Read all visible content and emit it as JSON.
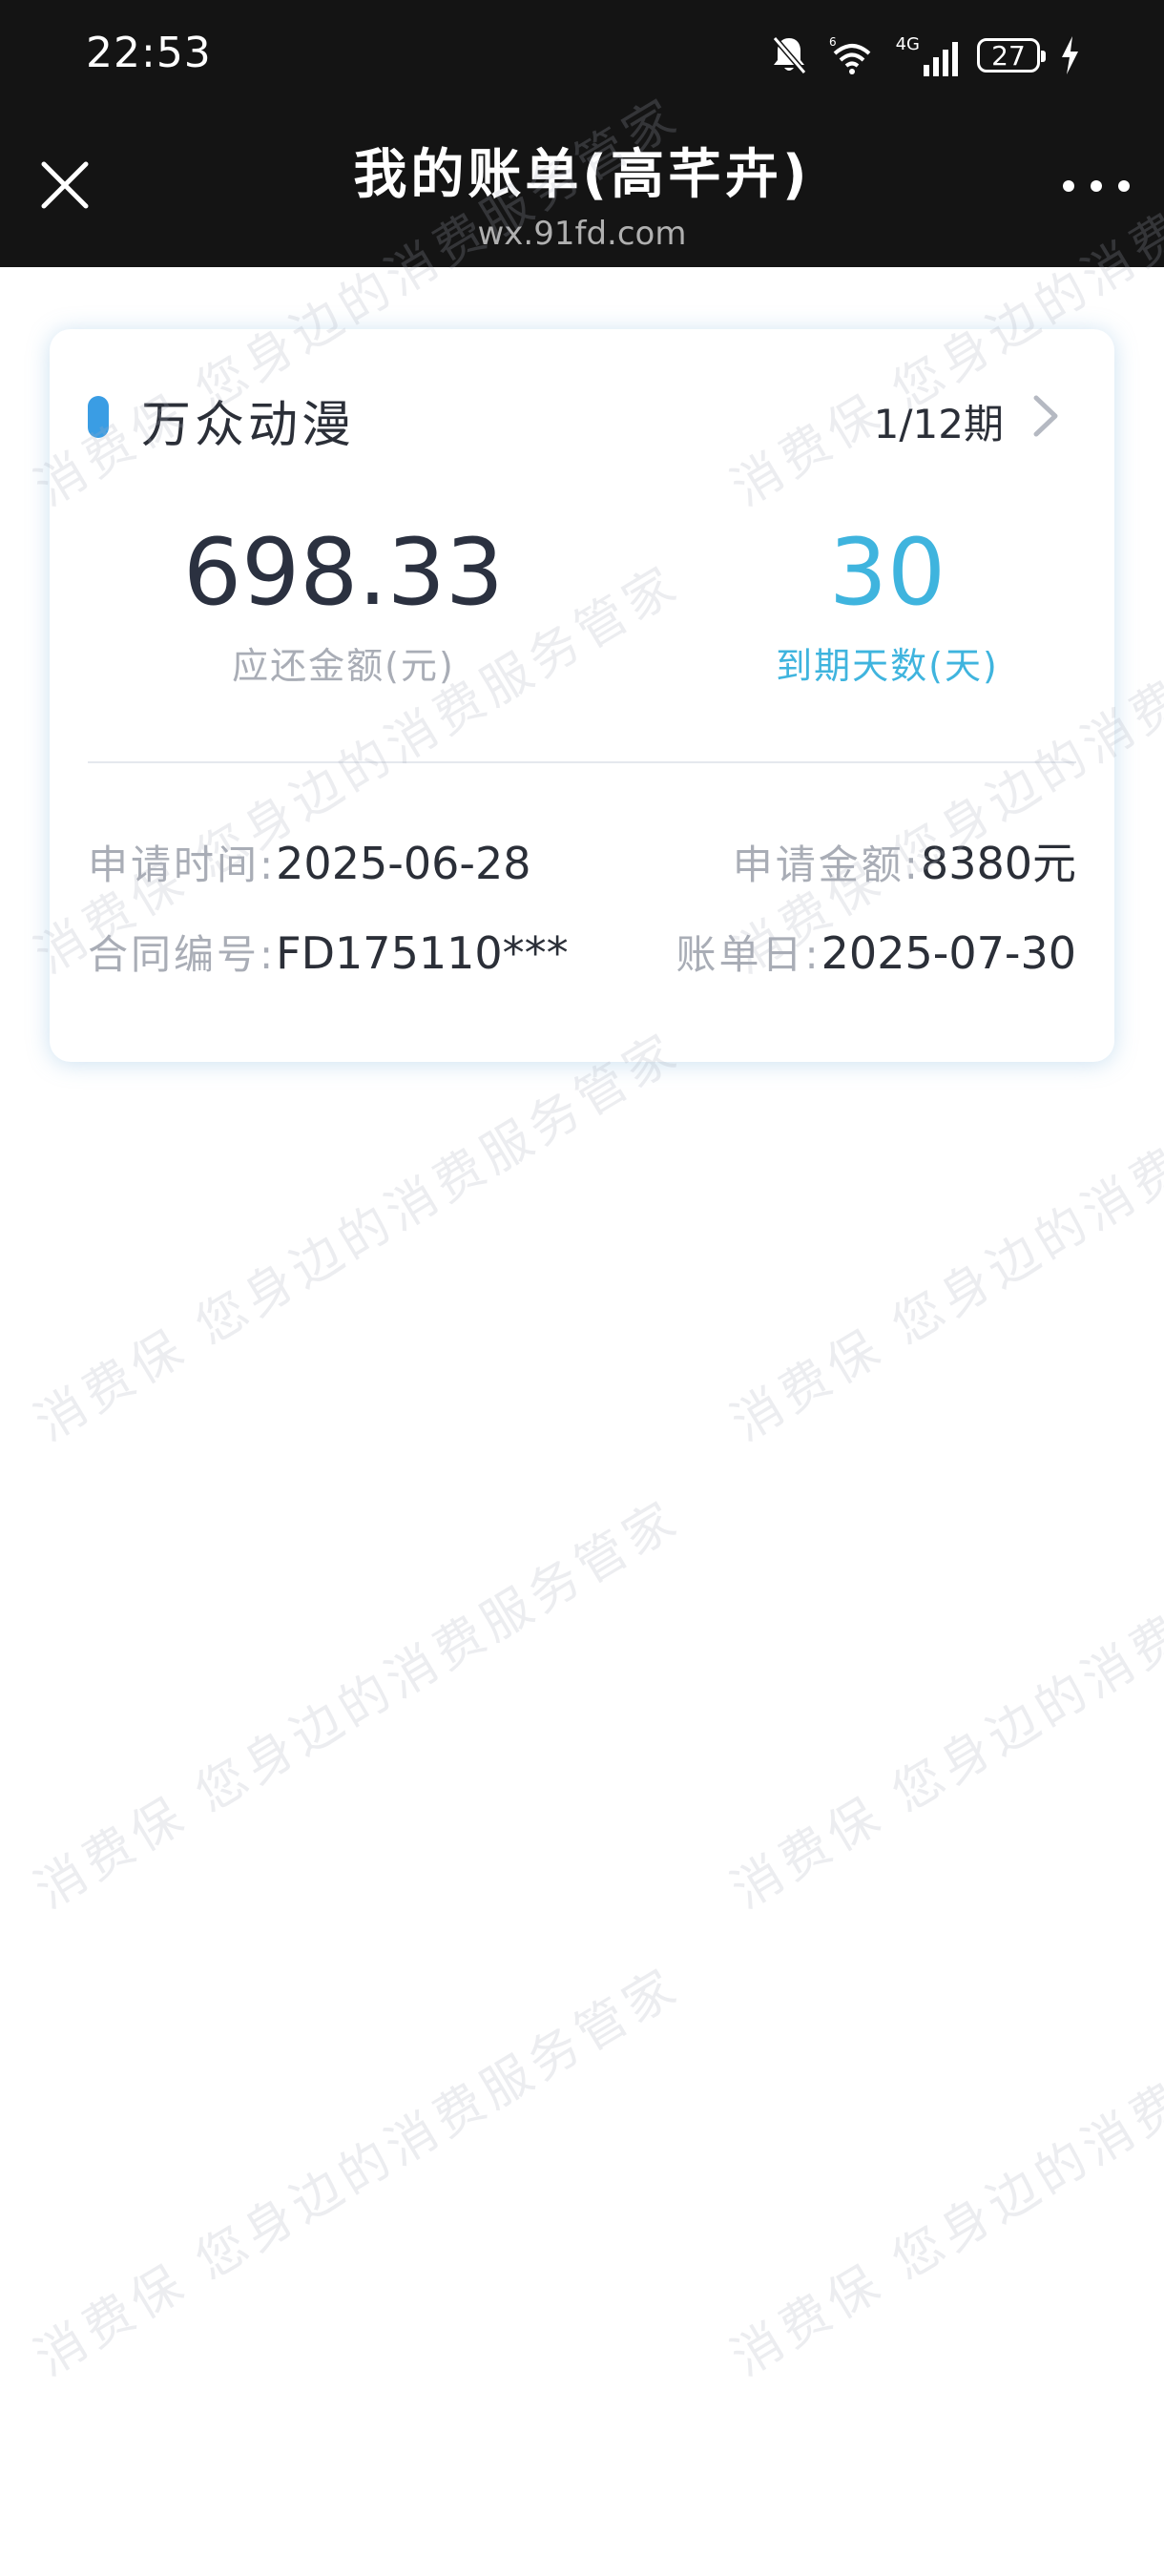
{
  "status_bar": {
    "time": "22:53",
    "network": "4G",
    "battery": "27"
  },
  "titlebar": {
    "title": "我的账单(高芊卉)",
    "subtitle": "wx.91fd.com"
  },
  "bill": {
    "merchant": "万众动漫",
    "period": "1/12期",
    "amount_due": "698.33",
    "amount_due_label": "应还金额(元)",
    "days_left": "30",
    "days_left_label": "到期天数(天)",
    "apply_time_label": "申请时间:",
    "apply_time": "2025-06-28",
    "apply_amount_label": "申请金额:",
    "apply_amount": "8380元",
    "contract_label": "合同编号:",
    "contract_no": "FD175110***",
    "bill_date_label": "账单日:",
    "bill_date": "2025-07-30"
  },
  "watermark": {
    "text": "消费保 您身边的消费服务管家"
  },
  "colors": {
    "header_bg": "#141414",
    "accent_blue": "#3fb4de",
    "merchant_bar": "#3a9de4"
  }
}
